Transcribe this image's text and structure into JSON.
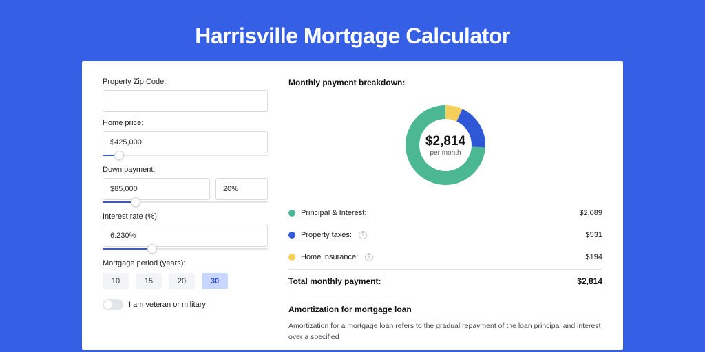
{
  "title": "Harrisville Mortgage Calculator",
  "form": {
    "zip_label": "Property Zip Code:",
    "zip_value": "",
    "home_price_label": "Home price:",
    "home_price_value": "$425,000",
    "home_price_slider_pct": 10,
    "down_label": "Down payment:",
    "down_value": "$85,000",
    "down_pct_value": "20%",
    "down_slider_pct": 20,
    "rate_label": "Interest rate (%):",
    "rate_value": "6.230%",
    "rate_slider_pct": 30,
    "period_label": "Mortgage period (years):",
    "period_options": [
      "10",
      "15",
      "20",
      "30"
    ],
    "period_selected": "30",
    "veteran_label": "I am veteran or military",
    "veteran_on": false
  },
  "summary": {
    "title": "Monthly payment breakdown:",
    "center_value": "$2,814",
    "center_label": "per month",
    "items": [
      {
        "key": "principal",
        "label": "Principal & Interest:",
        "value": "$2,089",
        "color": "#4bb793",
        "has_info": false,
        "pct": 74
      },
      {
        "key": "taxes",
        "label": "Property taxes:",
        "value": "$531",
        "color": "#2f58d6",
        "has_info": true,
        "pct": 19
      },
      {
        "key": "insurance",
        "label": "Home insurance:",
        "value": "$194",
        "color": "#f4cf5b",
        "has_info": true,
        "pct": 7
      }
    ],
    "total_label": "Total monthly payment:",
    "total_value": "$2,814"
  },
  "amort": {
    "title": "Amortization for mortgage loan",
    "body": "Amortization for a mortgage loan refers to the gradual repayment of the loan principal and interest over a specified"
  },
  "chart_data": {
    "type": "pie",
    "title": "Monthly payment breakdown",
    "categories": [
      "Principal & Interest",
      "Property taxes",
      "Home insurance"
    ],
    "values": [
      2089,
      531,
      194
    ],
    "colors": [
      "#4bb793",
      "#2f58d6",
      "#f4cf5b"
    ],
    "total": 2814,
    "center_label": "per month"
  }
}
